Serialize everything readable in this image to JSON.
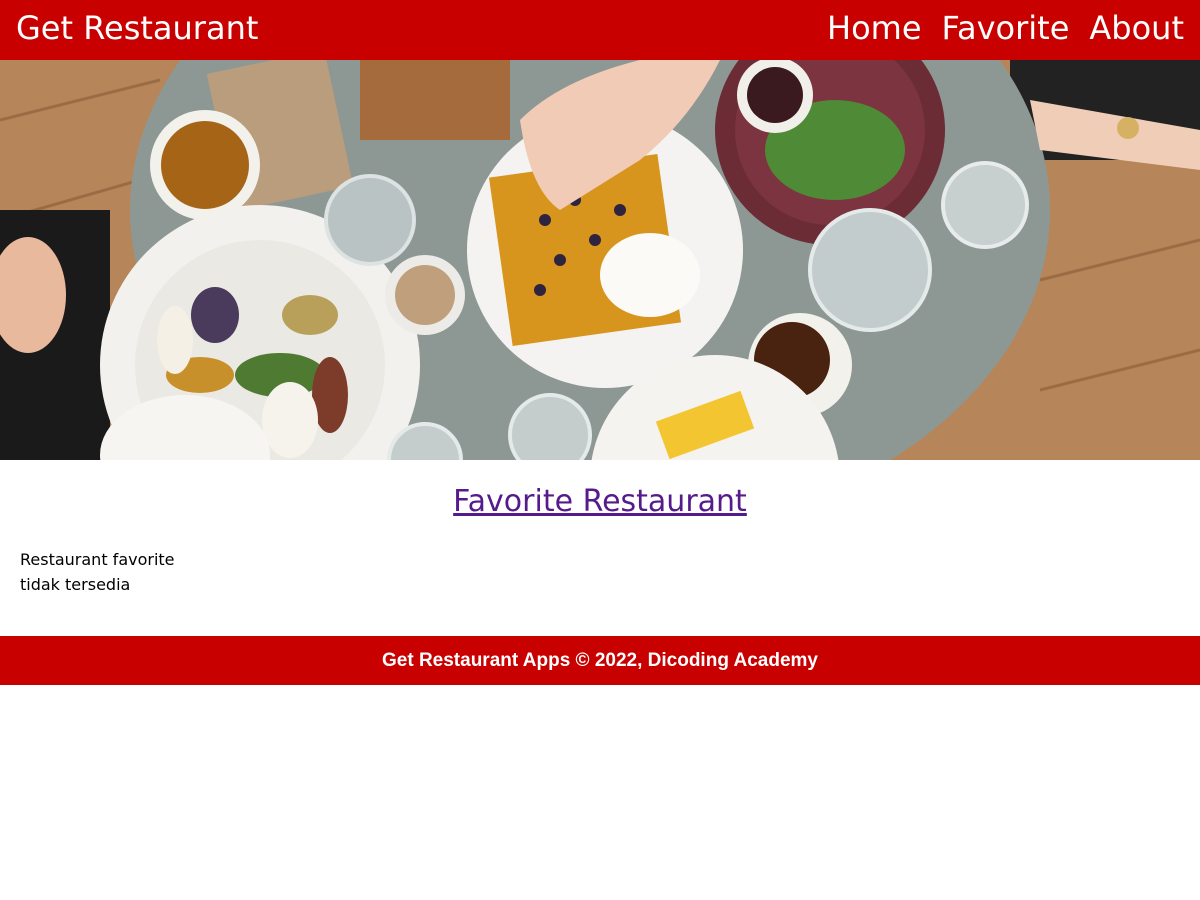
{
  "header": {
    "brand": "Get Restaurant",
    "nav": {
      "home": "Home",
      "favorite": "Favorite",
      "about": "About"
    }
  },
  "hero": {
    "image_icon": "food-table-hero-image"
  },
  "main": {
    "title": "Favorite Restaurant",
    "empty_message": "Restaurant favorite tidak tersedia"
  },
  "footer": {
    "text": "Get Restaurant Apps © 2022, Dicoding Academy"
  },
  "colors": {
    "brand": "#c80000",
    "link_visited": "#551a8b",
    "text": "#000000",
    "background": "#ffffff"
  }
}
